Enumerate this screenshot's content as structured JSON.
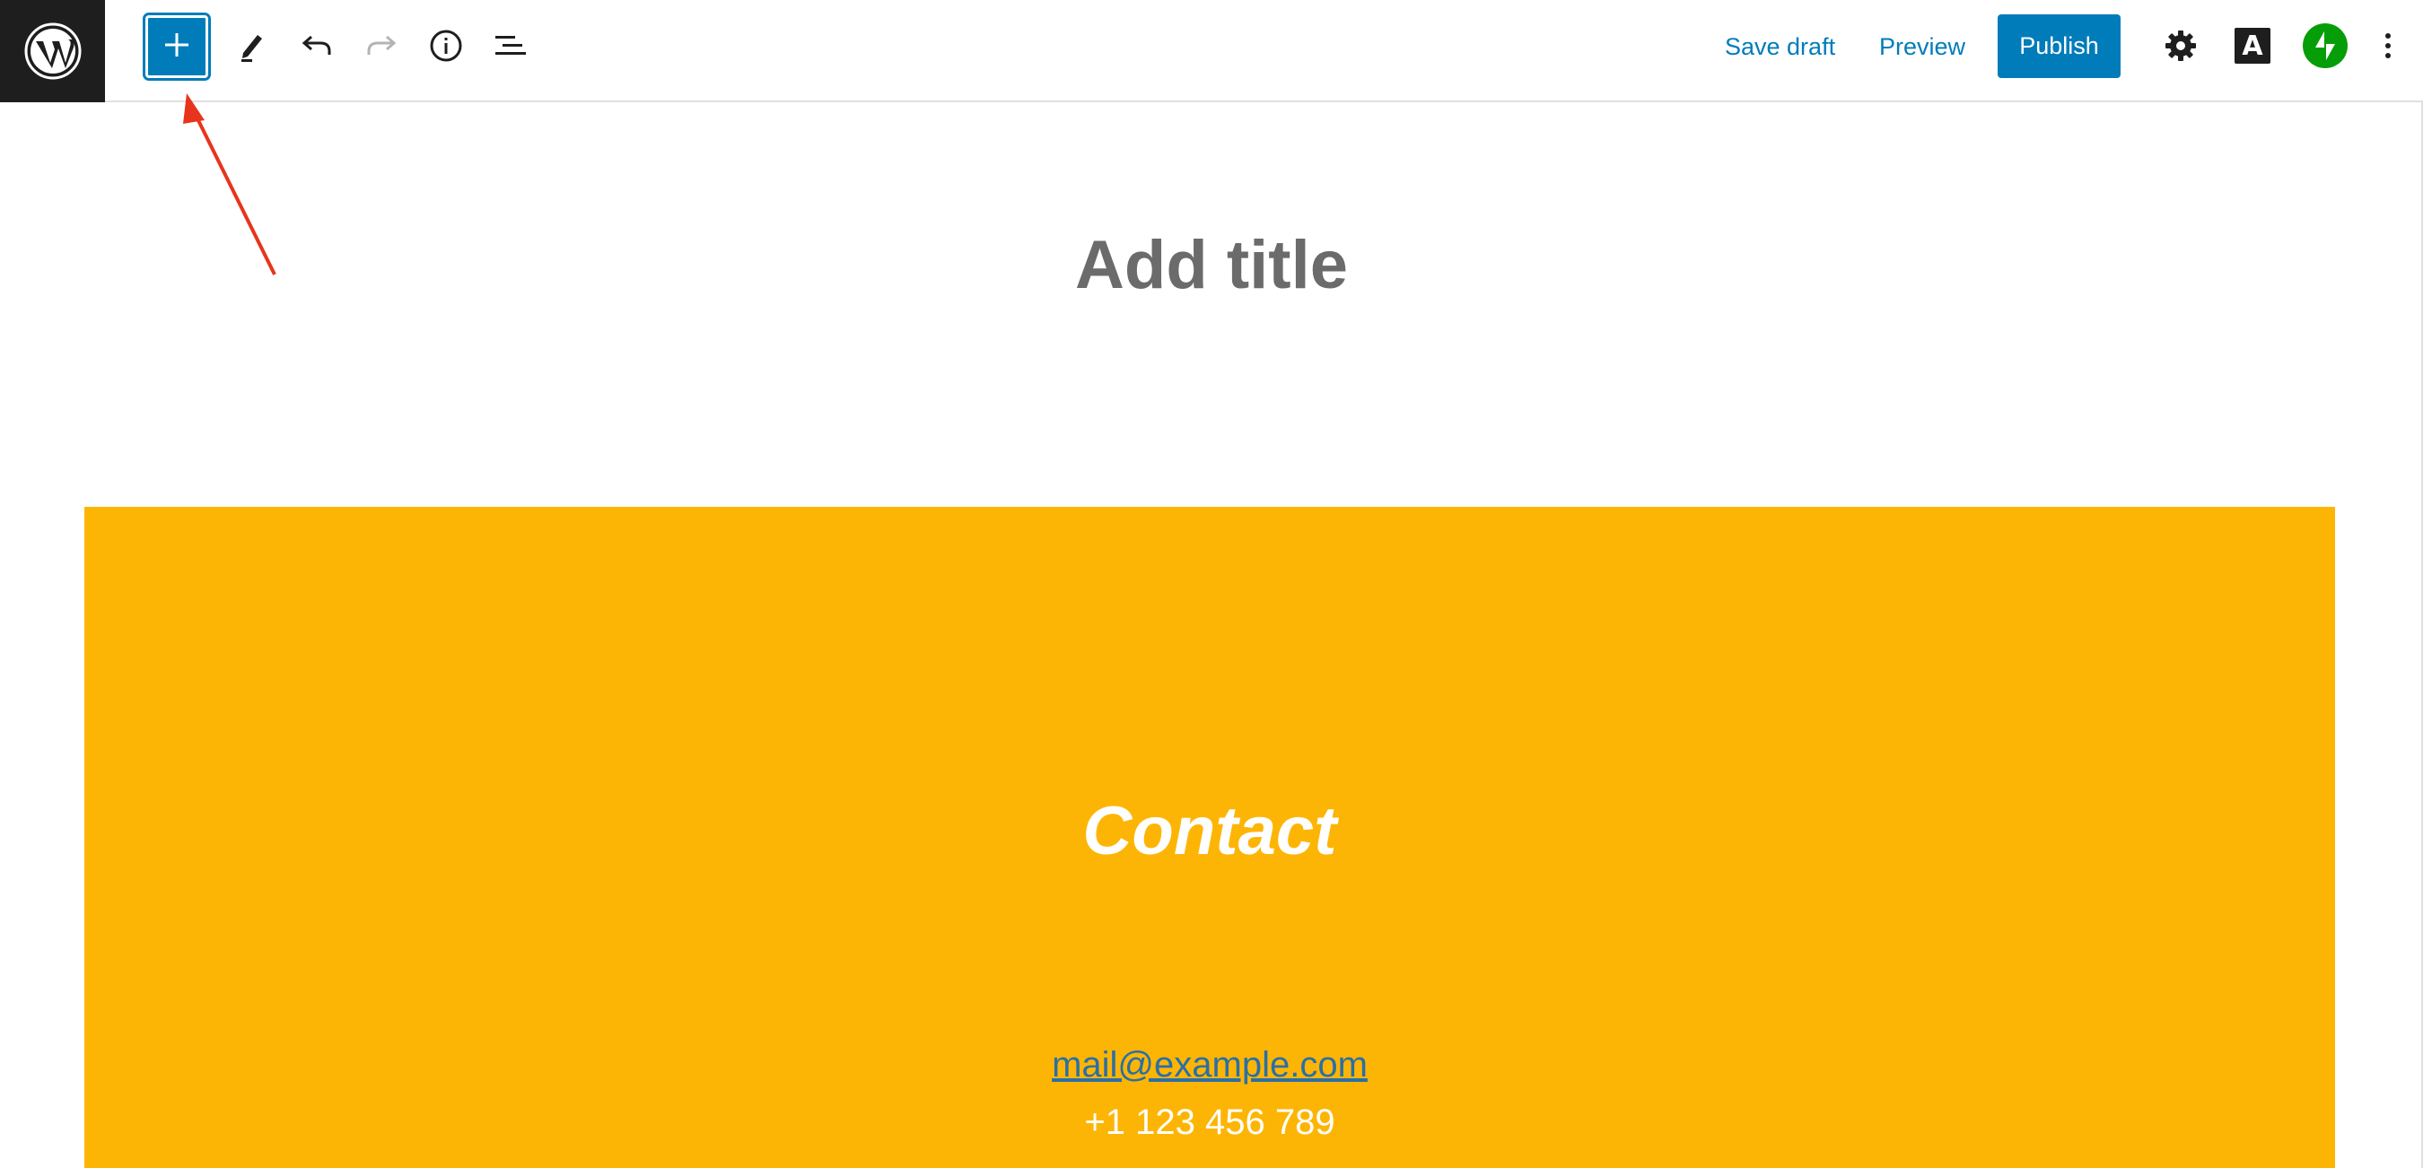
{
  "toolbar": {
    "save_draft_label": "Save draft",
    "preview_label": "Preview",
    "publish_label": "Publish",
    "font_button_label": "A"
  },
  "icons": {
    "logo": "wordpress-logo-icon",
    "inserter": "plus-icon",
    "tools": "pencil-icon",
    "undo": "undo-icon",
    "redo": "redo-icon",
    "details": "info-icon",
    "outline": "list-view-icon",
    "settings": "gear-icon",
    "jetpack": "jetpack-icon",
    "more": "kebab-menu-icon"
  },
  "colors": {
    "accent": "#007cba",
    "logo_bg": "#1e1e1e",
    "cover_bg": "#fdb505",
    "jetpack": "#069e08",
    "annotation_arrow": "#e8341c"
  },
  "editor": {
    "title_placeholder": "Add title",
    "cover": {
      "heading": "Contact",
      "email": "mail@example.com",
      "phone": "+1 123 456 789"
    }
  }
}
